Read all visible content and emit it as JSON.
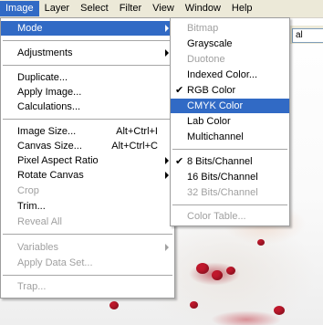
{
  "menubar": {
    "items": [
      "Image",
      "Layer",
      "Select",
      "Filter",
      "View",
      "Window",
      "Help"
    ]
  },
  "options": {
    "field_text": "al"
  },
  "image_menu": {
    "mode": "Mode",
    "adjustments": "Adjustments",
    "duplicate": "Duplicate...",
    "apply_image": "Apply Image...",
    "calculations": "Calculations...",
    "image_size": "Image Size...",
    "image_size_shortcut": "Alt+Ctrl+I",
    "canvas_size": "Canvas Size...",
    "canvas_size_shortcut": "Alt+Ctrl+C",
    "pixel_aspect_ratio": "Pixel Aspect Ratio",
    "rotate_canvas": "Rotate Canvas",
    "crop": "Crop",
    "trim": "Trim...",
    "reveal_all": "Reveal All",
    "variables": "Variables",
    "apply_data_set": "Apply Data Set...",
    "trap": "Trap..."
  },
  "mode_menu": {
    "bitmap": "Bitmap",
    "grayscale": "Grayscale",
    "duotone": "Duotone",
    "indexed_color": "Indexed Color...",
    "rgb_color": "RGB Color",
    "cmyk_color": "CMYK Color",
    "lab_color": "Lab Color",
    "multichannel": "Multichannel",
    "bits8": "8 Bits/Channel",
    "bits16": "16 Bits/Channel",
    "bits32": "32 Bits/Channel",
    "color_table": "Color Table...",
    "check_glyph": "✔"
  },
  "colors": {
    "highlight": "#316ac5",
    "menubar_bg": "#ece9d8",
    "disabled_text": "#a0a0a0"
  }
}
